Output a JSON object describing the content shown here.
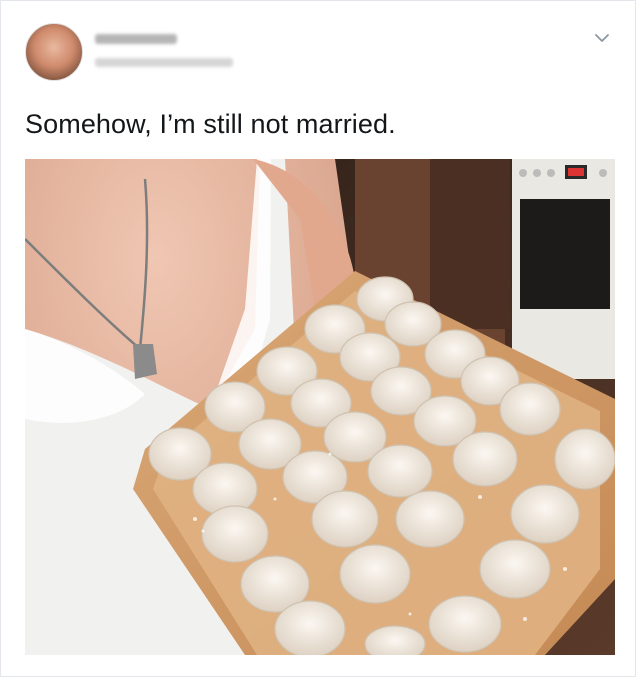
{
  "tweet": {
    "author_name": "",
    "author_handle": "",
    "text": "Somehow, I’m still not married."
  },
  "icons": {
    "avatar": "avatar-photo",
    "menu": "chevron-down-icon"
  },
  "media": {
    "description_kind": "photo",
    "colors": {
      "tray": "#d29a66",
      "dumpling": "#efe7dc",
      "dress": "#f1f1ef",
      "skin": "#e7b49c"
    }
  }
}
